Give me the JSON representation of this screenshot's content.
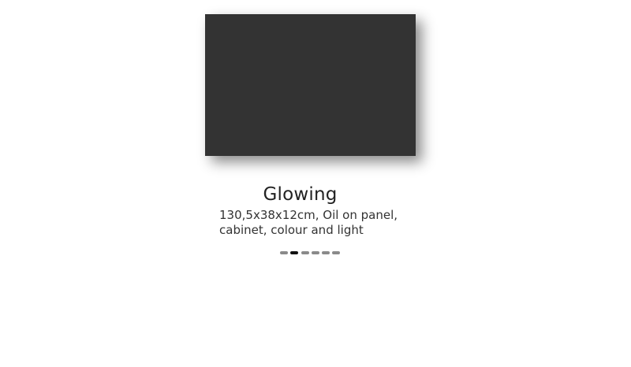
{
  "artwork": {
    "title": "Glowing",
    "details": "130,5x38x12cm, Oil on panel,\ncabinet, colour and light",
    "image_color": "#333333"
  },
  "pager": {
    "count": 6,
    "active_index": 1,
    "colors": {
      "active": "#111111",
      "inactive": "#8a8a8a"
    }
  }
}
